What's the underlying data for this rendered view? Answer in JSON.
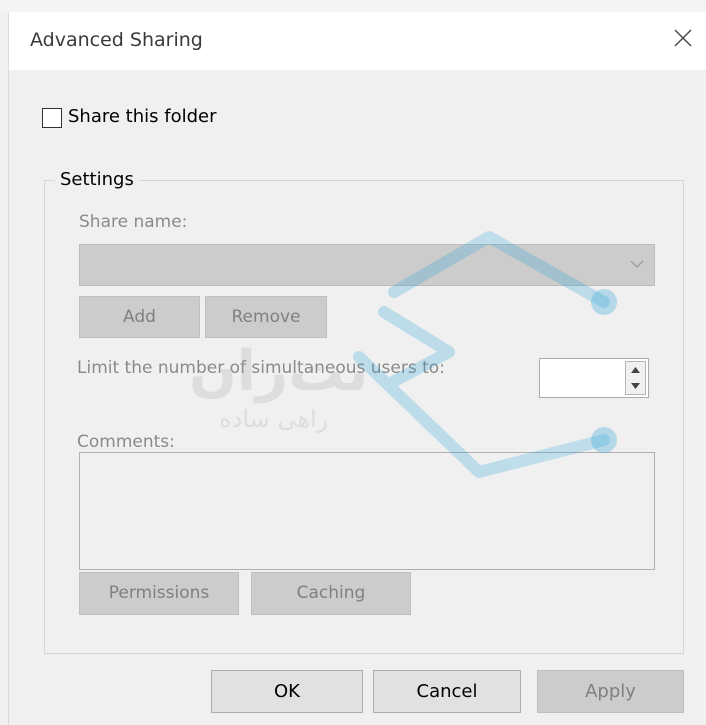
{
  "window": {
    "title": "Advanced Sharing"
  },
  "share_checkbox": {
    "label": "Share this folder",
    "checked": false
  },
  "settings": {
    "legend": "Settings",
    "share_name_label": "Share name:",
    "share_name_value": "",
    "add_label": "Add",
    "remove_label": "Remove",
    "limit_label": "Limit the number of simultaneous users to:",
    "limit_value": "",
    "comments_label": "Comments:",
    "comments_value": "",
    "permissions_label": "Permissions",
    "caching_label": "Caching"
  },
  "footer": {
    "ok_label": "OK",
    "cancel_label": "Cancel",
    "apply_label": "Apply"
  },
  "watermark": {
    "text_main": "نت‌ران",
    "text_sub": "راهی ساده",
    "color": "#2aa3d8"
  }
}
